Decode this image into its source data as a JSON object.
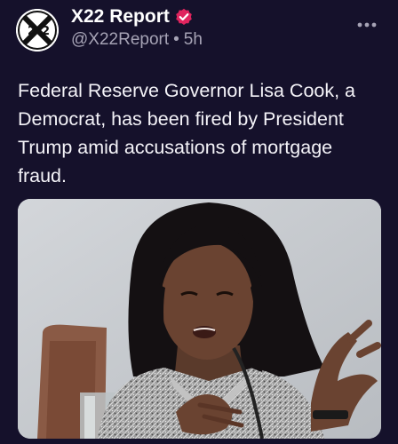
{
  "author": {
    "display_name": "X22 Report",
    "handle": "@X22Report",
    "separator": "•",
    "time_ago": "5h",
    "verified": true,
    "avatar_icon": "x22-logo-avatar",
    "avatar_logo_text": "X22"
  },
  "menu": {
    "icon": "more-options-icon"
  },
  "post": {
    "text": "Federal Reserve Governor Lisa Cook, a Democrat, has been fired by President Trump amid accusations of mortgage fraud."
  },
  "media": {
    "type": "photo"
  },
  "colors": {
    "background": "#15112b",
    "text": "#f4f3f8",
    "muted": "#a6a3b5",
    "verified_badge": "#e0245e"
  }
}
